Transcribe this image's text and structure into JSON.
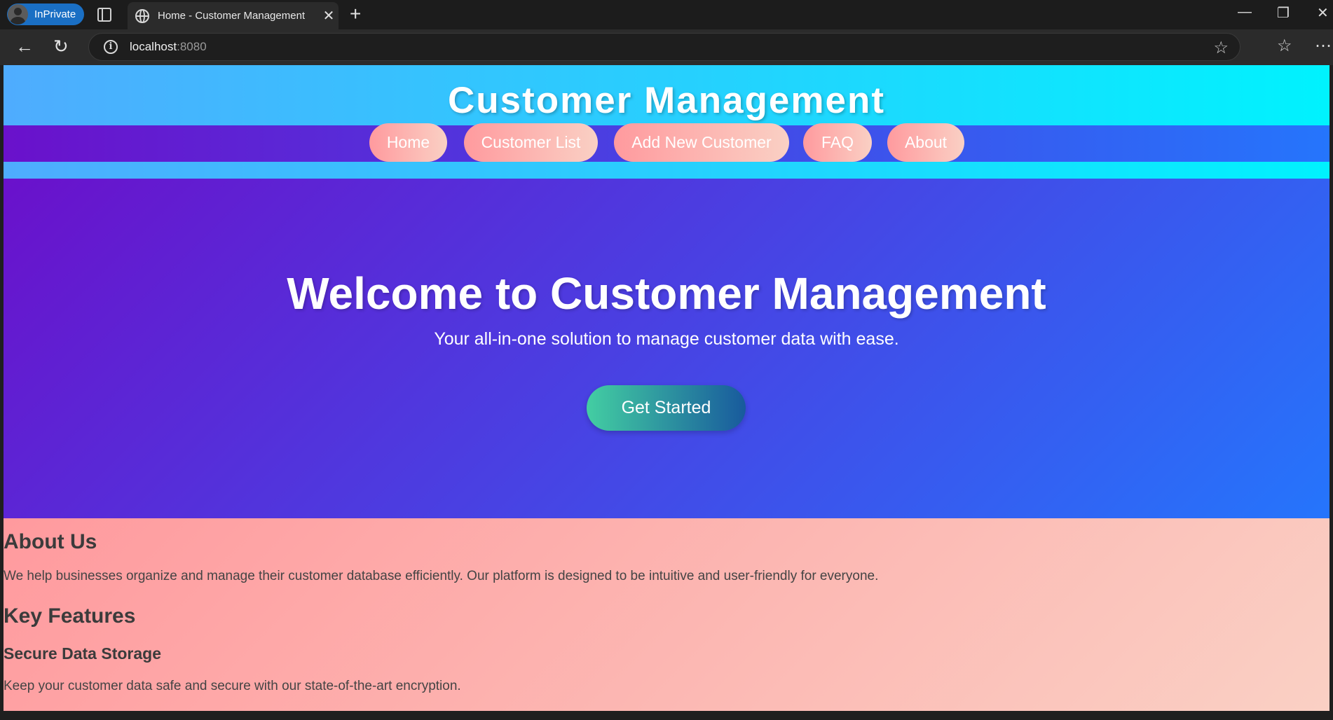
{
  "browser": {
    "profile_label": "InPrivate",
    "tab_title": "Home - Customer Management",
    "tab_close": "✕",
    "new_tab": "+",
    "address_host": "localhost",
    "address_port": ":8080",
    "window_controls": {
      "minimize": "—",
      "restore": "❐",
      "close": "✕"
    }
  },
  "header": {
    "title": "Customer Management",
    "nav": [
      "Home",
      "Customer List",
      "Add New Customer",
      "FAQ",
      "About"
    ]
  },
  "hero": {
    "heading": "Welcome to Customer Management",
    "subheading": "Your all-in-one solution to manage customer data with ease.",
    "cta_label": "Get Started"
  },
  "info": {
    "about_heading": "About Us",
    "about_text": "We help businesses organize and manage their customer database efficiently. Our platform is designed to be intuitive and user-friendly for everyone.",
    "features_heading": "Key Features",
    "feature1_title": "Secure Data Storage",
    "feature1_text": "Keep your customer data safe and secure with our state-of-the-art encryption."
  },
  "colors": {
    "header_gradient": [
      "#4facfe",
      "#00f2fe"
    ],
    "nav_gradient": [
      "#6a11cb",
      "#2575fc"
    ],
    "button_gradient": [
      "#ff9a9e",
      "#fad0c4"
    ],
    "cta_gradient": [
      "#43cea2",
      "#185a9d"
    ],
    "info_gradient": [
      "#ff9a9e",
      "#fad0c4"
    ]
  }
}
